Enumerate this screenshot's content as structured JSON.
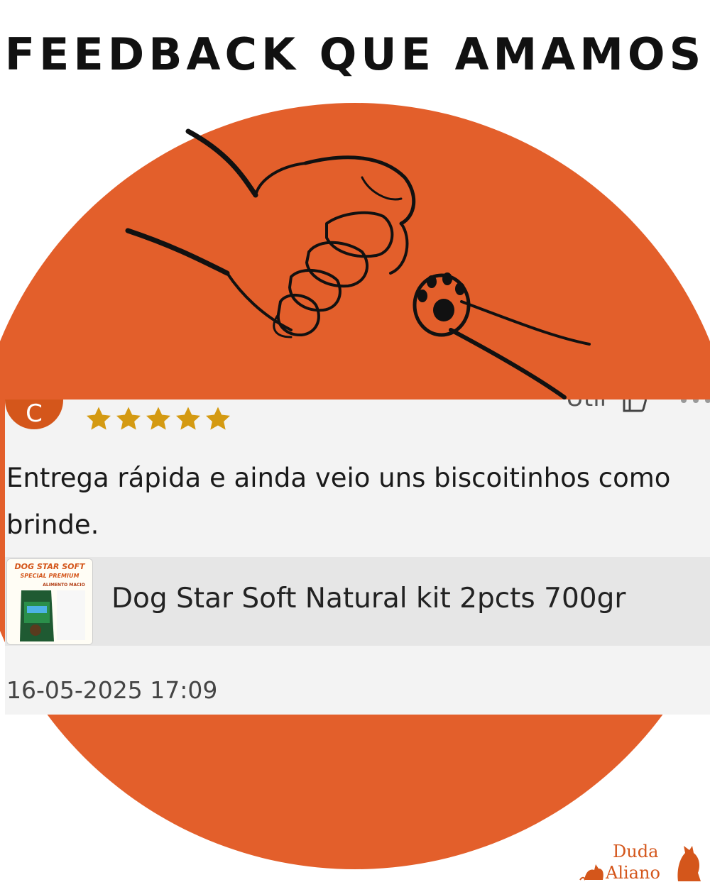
{
  "header": {
    "title": "FEEDBACK QUE AMAMOS"
  },
  "review": {
    "avatar_initial": "C",
    "rating": 5,
    "helpful_label": "Útil",
    "text": "Entrega rápida e ainda veio uns biscoitinhos como brinde.",
    "product_name": "Dog Star Soft Natural kit 2pcts 700gr",
    "date": "16-05-2025 17:09"
  },
  "thumbnail": {
    "line1": "DOG STAR SOFT",
    "line2": "SPECIAL PREMIUM",
    "line3": "ALIMENTO MACIO"
  },
  "brand": {
    "line1": "Duda",
    "line2": "Aliano"
  },
  "colors": {
    "accent": "#e35f2b",
    "star": "#d49a12",
    "card": "#f3f3f3"
  }
}
